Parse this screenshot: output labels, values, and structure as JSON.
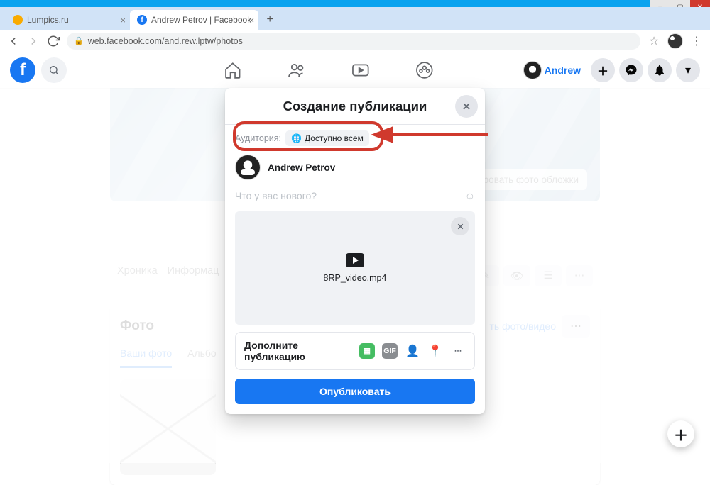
{
  "window": {
    "tabs": [
      {
        "title": "Lumpics.ru",
        "fav_color": "#f9ab00"
      },
      {
        "title": "Andrew Petrov | Facebook",
        "fav_fb": true
      }
    ]
  },
  "url": "web.facebook.com/and.rew.lptw/photos",
  "header": {
    "user_name": "Andrew"
  },
  "cover": {
    "edit_label": "ктировать фото обложки"
  },
  "profile_tabs": {
    "timeline": "Хроника",
    "about": "Информац"
  },
  "photos_card": {
    "title": "Фото",
    "add_label": "ть фото/видео",
    "subtabs": {
      "your": "Ваши фото",
      "albums": "Альбо"
    }
  },
  "modal": {
    "title": "Создание публикации",
    "audience_label": "Аудитория:",
    "audience_value": "Доступно всем",
    "user": "Andrew Petrov",
    "placeholder": "Что у вас нового?",
    "file": "8RP_video.mp4",
    "enhance": "Дополните публикацию",
    "submit": "Опубликовать"
  }
}
